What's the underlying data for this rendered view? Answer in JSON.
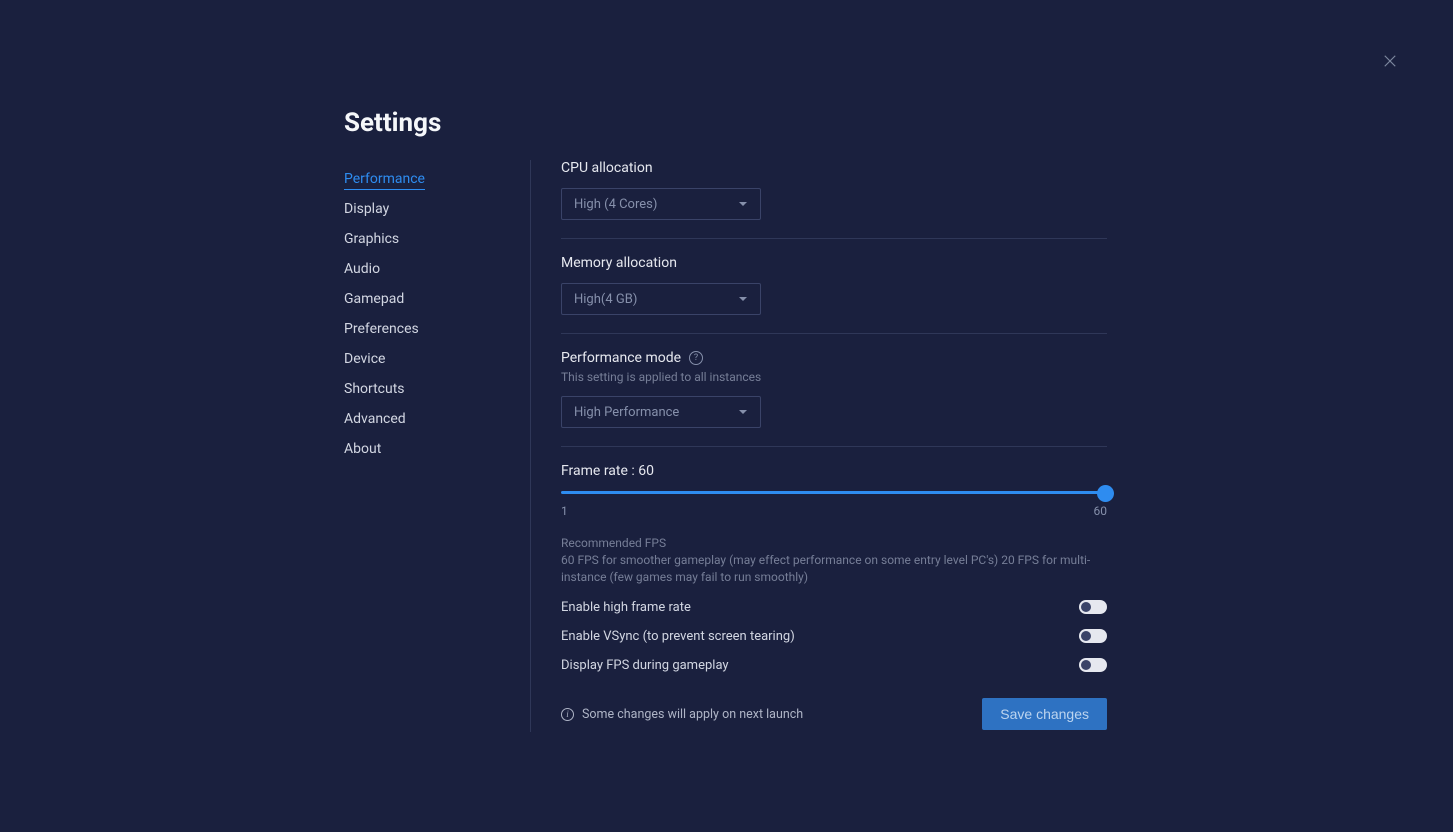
{
  "title": "Settings",
  "sidebar": {
    "items": [
      {
        "label": "Performance",
        "active": true
      },
      {
        "label": "Display",
        "active": false
      },
      {
        "label": "Graphics",
        "active": false
      },
      {
        "label": "Audio",
        "active": false
      },
      {
        "label": "Gamepad",
        "active": false
      },
      {
        "label": "Preferences",
        "active": false
      },
      {
        "label": "Device",
        "active": false
      },
      {
        "label": "Shortcuts",
        "active": false
      },
      {
        "label": "Advanced",
        "active": false
      },
      {
        "label": "About",
        "active": false
      }
    ]
  },
  "cpu": {
    "label": "CPU allocation",
    "value": "High (4 Cores)"
  },
  "memory": {
    "label": "Memory allocation",
    "value": "High(4 GB)"
  },
  "perfmode": {
    "label": "Performance mode",
    "subtitle": "This setting is applied to all instances",
    "value": "High Performance"
  },
  "framerate": {
    "label": "Frame rate : 60",
    "min": "1",
    "max": "60",
    "recommended_heading": "Recommended FPS",
    "recommended_body": "60 FPS for smoother gameplay (may effect performance on some entry level PC's) 20 FPS for multi-instance (few games may fail to run smoothly)"
  },
  "toggles": {
    "high_fps": "Enable high frame rate",
    "vsync": "Enable VSync (to prevent screen tearing)",
    "display_fps": "Display FPS during gameplay"
  },
  "footer": {
    "note": "Some changes will apply on next launch",
    "save": "Save changes"
  }
}
